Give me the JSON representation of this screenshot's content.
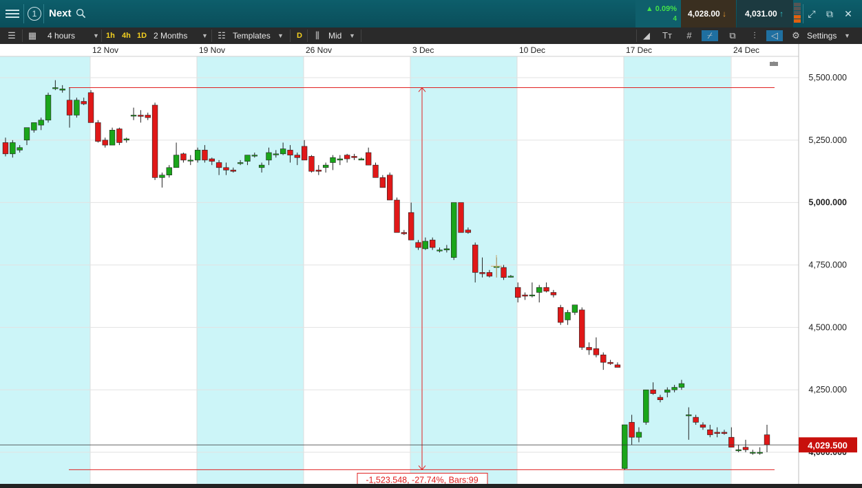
{
  "topbar": {
    "window_number": "1",
    "instrument": "Next",
    "change_pct": "0.09%",
    "change_count": "4",
    "sell_price": "4,028.00",
    "buy_price": "4,031.00"
  },
  "toolbar": {
    "interval": "4 hours",
    "quick_intervals": [
      "1h",
      "4h",
      "1D"
    ],
    "range": "2 Months",
    "templates_label": "Templates",
    "d_label": "D",
    "price_type": "Mid",
    "settings_label": "Settings"
  },
  "chart_data": {
    "type": "candlestick",
    "x_labels": [
      "12 Nov",
      "19 Nov",
      "26 Nov",
      "3 Dec",
      "10 Dec",
      "17 Dec",
      "24 Dec"
    ],
    "y_ticks": [
      "5,500.000",
      "5,250.000",
      "5,000.000",
      "4,750.000",
      "4,500.000",
      "4,250.000",
      "4,000.000"
    ],
    "y_tick_values": [
      5500,
      5250,
      5000,
      4750,
      4500,
      4250,
      4000
    ],
    "current_price_label": "4,029.500",
    "current_price": 4029.5,
    "measure_label": "-1,523.548, -27.74%, Bars:99",
    "measure_high": 5460,
    "measure_low": 3930,
    "colors": {
      "up": "#1aa51a",
      "down": "#e01818",
      "shade": "#ccf5f8",
      "measure": "#e02020",
      "price_badge": "#c8100c"
    },
    "candles": [
      [
        5240,
        5260,
        5185,
        5195
      ],
      [
        5195,
        5250,
        5180,
        5240
      ],
      [
        5210,
        5230,
        5200,
        5220
      ],
      [
        5250,
        5280,
        5230,
        5300
      ],
      [
        5290,
        5320,
        5280,
        5320
      ],
      [
        5310,
        5340,
        5290,
        5330
      ],
      [
        5330,
        5440,
        5320,
        5430
      ],
      [
        5460,
        5490,
        5450,
        5460
      ],
      [
        5450,
        5470,
        5440,
        5455
      ],
      [
        5410,
        5460,
        5300,
        5350
      ],
      [
        5350,
        5420,
        5340,
        5410
      ],
      [
        5405,
        5420,
        5390,
        5395
      ],
      [
        5440,
        5450,
        5320,
        5320
      ],
      [
        5320,
        5330,
        5240,
        5245
      ],
      [
        5250,
        5260,
        5220,
        5230
      ],
      [
        5230,
        5300,
        5230,
        5290
      ],
      [
        5295,
        5300,
        5230,
        5240
      ],
      [
        5250,
        5260,
        5240,
        5255
      ],
      [
        5350,
        5380,
        5330,
        5350
      ],
      [
        5350,
        5370,
        5320,
        5345
      ],
      [
        5350,
        5360,
        5330,
        5340
      ],
      [
        5390,
        5400,
        5090,
        5100
      ],
      [
        5100,
        5120,
        5060,
        5110
      ],
      [
        5110,
        5150,
        5100,
        5140
      ],
      [
        5140,
        5240,
        5140,
        5190
      ],
      [
        5195,
        5200,
        5160,
        5170
      ],
      [
        5170,
        5190,
        5150,
        5170
      ],
      [
        5170,
        5220,
        5160,
        5210
      ],
      [
        5210,
        5230,
        5160,
        5170
      ],
      [
        5175,
        5180,
        5150,
        5165
      ],
      [
        5160,
        5170,
        5110,
        5140
      ],
      [
        5140,
        5160,
        5110,
        5130
      ],
      [
        5130,
        5140,
        5120,
        5125
      ],
      [
        5160,
        5170,
        5150,
        5160
      ],
      [
        5165,
        5190,
        5150,
        5190
      ],
      [
        5190,
        5200,
        5180,
        5190
      ],
      [
        5140,
        5160,
        5120,
        5150
      ],
      [
        5170,
        5220,
        5150,
        5200
      ],
      [
        5195,
        5210,
        5180,
        5195
      ],
      [
        5195,
        5240,
        5190,
        5215
      ],
      [
        5210,
        5230,
        5160,
        5190
      ],
      [
        5190,
        5200,
        5150,
        5180
      ],
      [
        5225,
        5250,
        5170,
        5170
      ],
      [
        5185,
        5190,
        5120,
        5125
      ],
      [
        5130,
        5150,
        5110,
        5125
      ],
      [
        5140,
        5160,
        5120,
        5150
      ],
      [
        5160,
        5190,
        5130,
        5180
      ],
      [
        5170,
        5190,
        5150,
        5175
      ],
      [
        5190,
        5195,
        5160,
        5175
      ],
      [
        5185,
        5195,
        5170,
        5180
      ],
      [
        5170,
        5180,
        5170,
        5175
      ],
      [
        5200,
        5220,
        5150,
        5150
      ],
      [
        5150,
        5160,
        5100,
        5100
      ],
      [
        5100,
        5110,
        5060,
        5060
      ],
      [
        5110,
        5120,
        5010,
        5010
      ],
      [
        5010,
        5020,
        4880,
        4880
      ],
      [
        4880,
        4890,
        4870,
        4875
      ],
      [
        4960,
        5000,
        4850,
        4850
      ],
      [
        4840,
        4850,
        4810,
        4820
      ],
      [
        4815,
        4860,
        4810,
        4845
      ],
      [
        4850,
        4860,
        4810,
        4820
      ],
      [
        4810,
        4820,
        4800,
        4810
      ],
      [
        4810,
        4830,
        4800,
        4815
      ],
      [
        4780,
        5000,
        4770,
        5000
      ],
      [
        5000,
        5000,
        4880,
        4880
      ],
      [
        4890,
        4900,
        4875,
        4880
      ],
      [
        4830,
        4840,
        4680,
        4720
      ],
      [
        4720,
        4780,
        4700,
        4715
      ],
      [
        4720,
        4730,
        4700,
        4705
      ],
      [
        4740,
        4780,
        4700,
        4745
      ],
      [
        4740,
        4750,
        4690,
        4700
      ],
      [
        4705,
        4710,
        4700,
        4705
      ],
      [
        4660,
        4680,
        4600,
        4620
      ],
      [
        4630,
        4640,
        4610,
        4625
      ],
      [
        4630,
        4680,
        4620,
        4630
      ],
      [
        4640,
        4670,
        4600,
        4660
      ],
      [
        4660,
        4680,
        4640,
        4645
      ],
      [
        4640,
        4650,
        4620,
        4630
      ],
      [
        4580,
        4590,
        4510,
        4520
      ],
      [
        4530,
        4570,
        4510,
        4560
      ],
      [
        4560,
        4590,
        4550,
        4590
      ],
      [
        4570,
        4580,
        4410,
        4420
      ],
      [
        4420,
        4440,
        4390,
        4410
      ],
      [
        4415,
        4460,
        4380,
        4390
      ],
      [
        4390,
        4400,
        4330,
        4360
      ],
      [
        4360,
        4370,
        4350,
        4355
      ],
      [
        4350,
        4360,
        4340,
        4340
      ],
      [
        3935,
        4110,
        3930,
        4110
      ],
      [
        4120,
        4150,
        4030,
        4060
      ],
      [
        4060,
        4100,
        4040,
        4080
      ],
      [
        4120,
        4250,
        4110,
        4250
      ],
      [
        4250,
        4280,
        4230,
        4235
      ],
      [
        4220,
        4230,
        4200,
        4210
      ],
      [
        4240,
        4260,
        4220,
        4250
      ],
      [
        4250,
        4270,
        4240,
        4260
      ],
      [
        4260,
        4290,
        4250,
        4275
      ],
      [
        4150,
        4180,
        4050,
        4150
      ],
      [
        4140,
        4150,
        4110,
        4120
      ],
      [
        4110,
        4120,
        4090,
        4100
      ],
      [
        4090,
        4110,
        4060,
        4070
      ],
      [
        4080,
        4100,
        4060,
        4075
      ],
      [
        4080,
        4090,
        4070,
        4075
      ],
      [
        4060,
        4100,
        4020,
        4020
      ],
      [
        4010,
        4030,
        4000,
        4010
      ],
      [
        4020,
        4050,
        4000,
        4010
      ],
      [
        4000,
        4010,
        3990,
        4000
      ],
      [
        4000,
        4020,
        3990,
        4000
      ],
      [
        4070,
        4110,
        4000,
        4030
      ]
    ]
  }
}
